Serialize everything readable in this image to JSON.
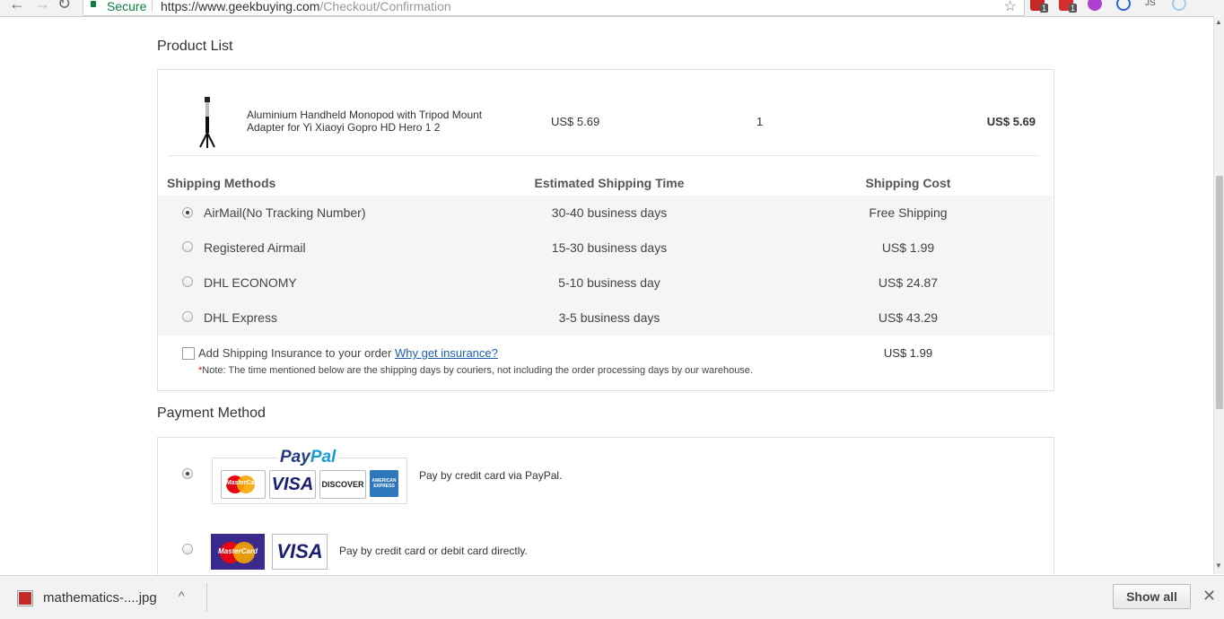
{
  "browser": {
    "secure_label": "Secure",
    "url_host": "https://www.geekbuying.com",
    "url_path": "/Checkout/Confirmation",
    "ext1_badge": "1",
    "ext2_badge": "1",
    "ext3_label": "JS"
  },
  "product_list": {
    "title": "Product List",
    "item": {
      "name": "Aluminium Handheld Monopod with Tripod Mount Adapter for Yi Xiaoyi Gopro HD Hero 1 2",
      "price": "US$ 5.69",
      "quantity": "1",
      "total": "US$ 5.69"
    },
    "shipping_headers": {
      "method": "Shipping Methods",
      "time": "Estimated Shipping Time",
      "cost": "Shipping Cost"
    },
    "shipping_options": [
      {
        "name": "AirMail(No Tracking Number)",
        "time": "30-40 business days",
        "cost": "Free Shipping",
        "selected": true
      },
      {
        "name": "Registered Airmail",
        "time": "15-30 business days",
        "cost": "US$ 1.99",
        "selected": false
      },
      {
        "name": "DHL ECONOMY",
        "time": "5-10 business day",
        "cost": "US$ 24.87",
        "selected": false
      },
      {
        "name": "DHL Express",
        "time": "3-5 business days",
        "cost": "US$ 43.29",
        "selected": false
      }
    ],
    "insurance": {
      "label": "Add Shipping Insurance to your order",
      "link": "Why get insurance?",
      "cost": "US$ 1.99"
    },
    "note_star": "*",
    "note": "Note: The time mentioned below are the shipping days by couriers, not including the order processing days by our warehouse."
  },
  "payment": {
    "title": "Payment Method",
    "paypal_logo_pay": "Pay",
    "paypal_logo_pal": "Pal",
    "card_mastercard": "MasterCard",
    "card_visa": "VISA",
    "card_discover": "DISCOVER",
    "card_amex": "AMERICAN EXPRESS",
    "options": [
      {
        "desc": "Pay by credit card via PayPal."
      },
      {
        "desc": "Pay by credit card or debit card directly."
      }
    ]
  },
  "download_bar": {
    "file_name": "mathematics-....jpg",
    "show_all": "Show all"
  },
  "colors": {
    "accent_link": "#1a5fb4",
    "secure_green": "#0b8043",
    "note_star": "#e00000"
  }
}
